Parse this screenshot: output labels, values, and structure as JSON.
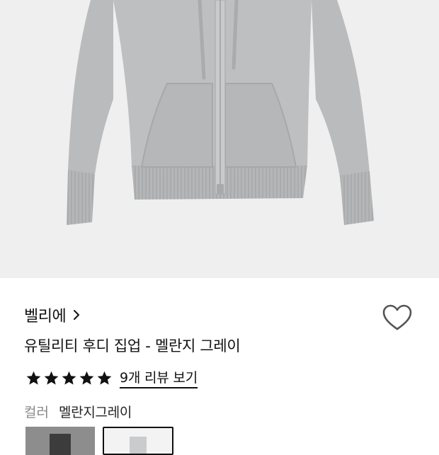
{
  "product": {
    "brand": "벨리에",
    "title": "유틸리티 후디 집업 - 멜란지 그레이",
    "rating": 5,
    "reviews_label": "9개 리뷰 보기",
    "color_label": "컬러",
    "color_value": "멜란지그레이"
  },
  "icons": {
    "brand_link": "chevron-right-icon",
    "wishlist": "heart-outline-icon",
    "star": "star-icon"
  },
  "swatches": [
    {
      "name": "charcoal",
      "color": "#8d8d8d"
    },
    {
      "name": "melange-gray",
      "color": "#c9cbcc",
      "selected": true
    }
  ],
  "colors": {
    "hoodie": "#b9bbbc",
    "background": "#efefef",
    "star": "#111111"
  }
}
